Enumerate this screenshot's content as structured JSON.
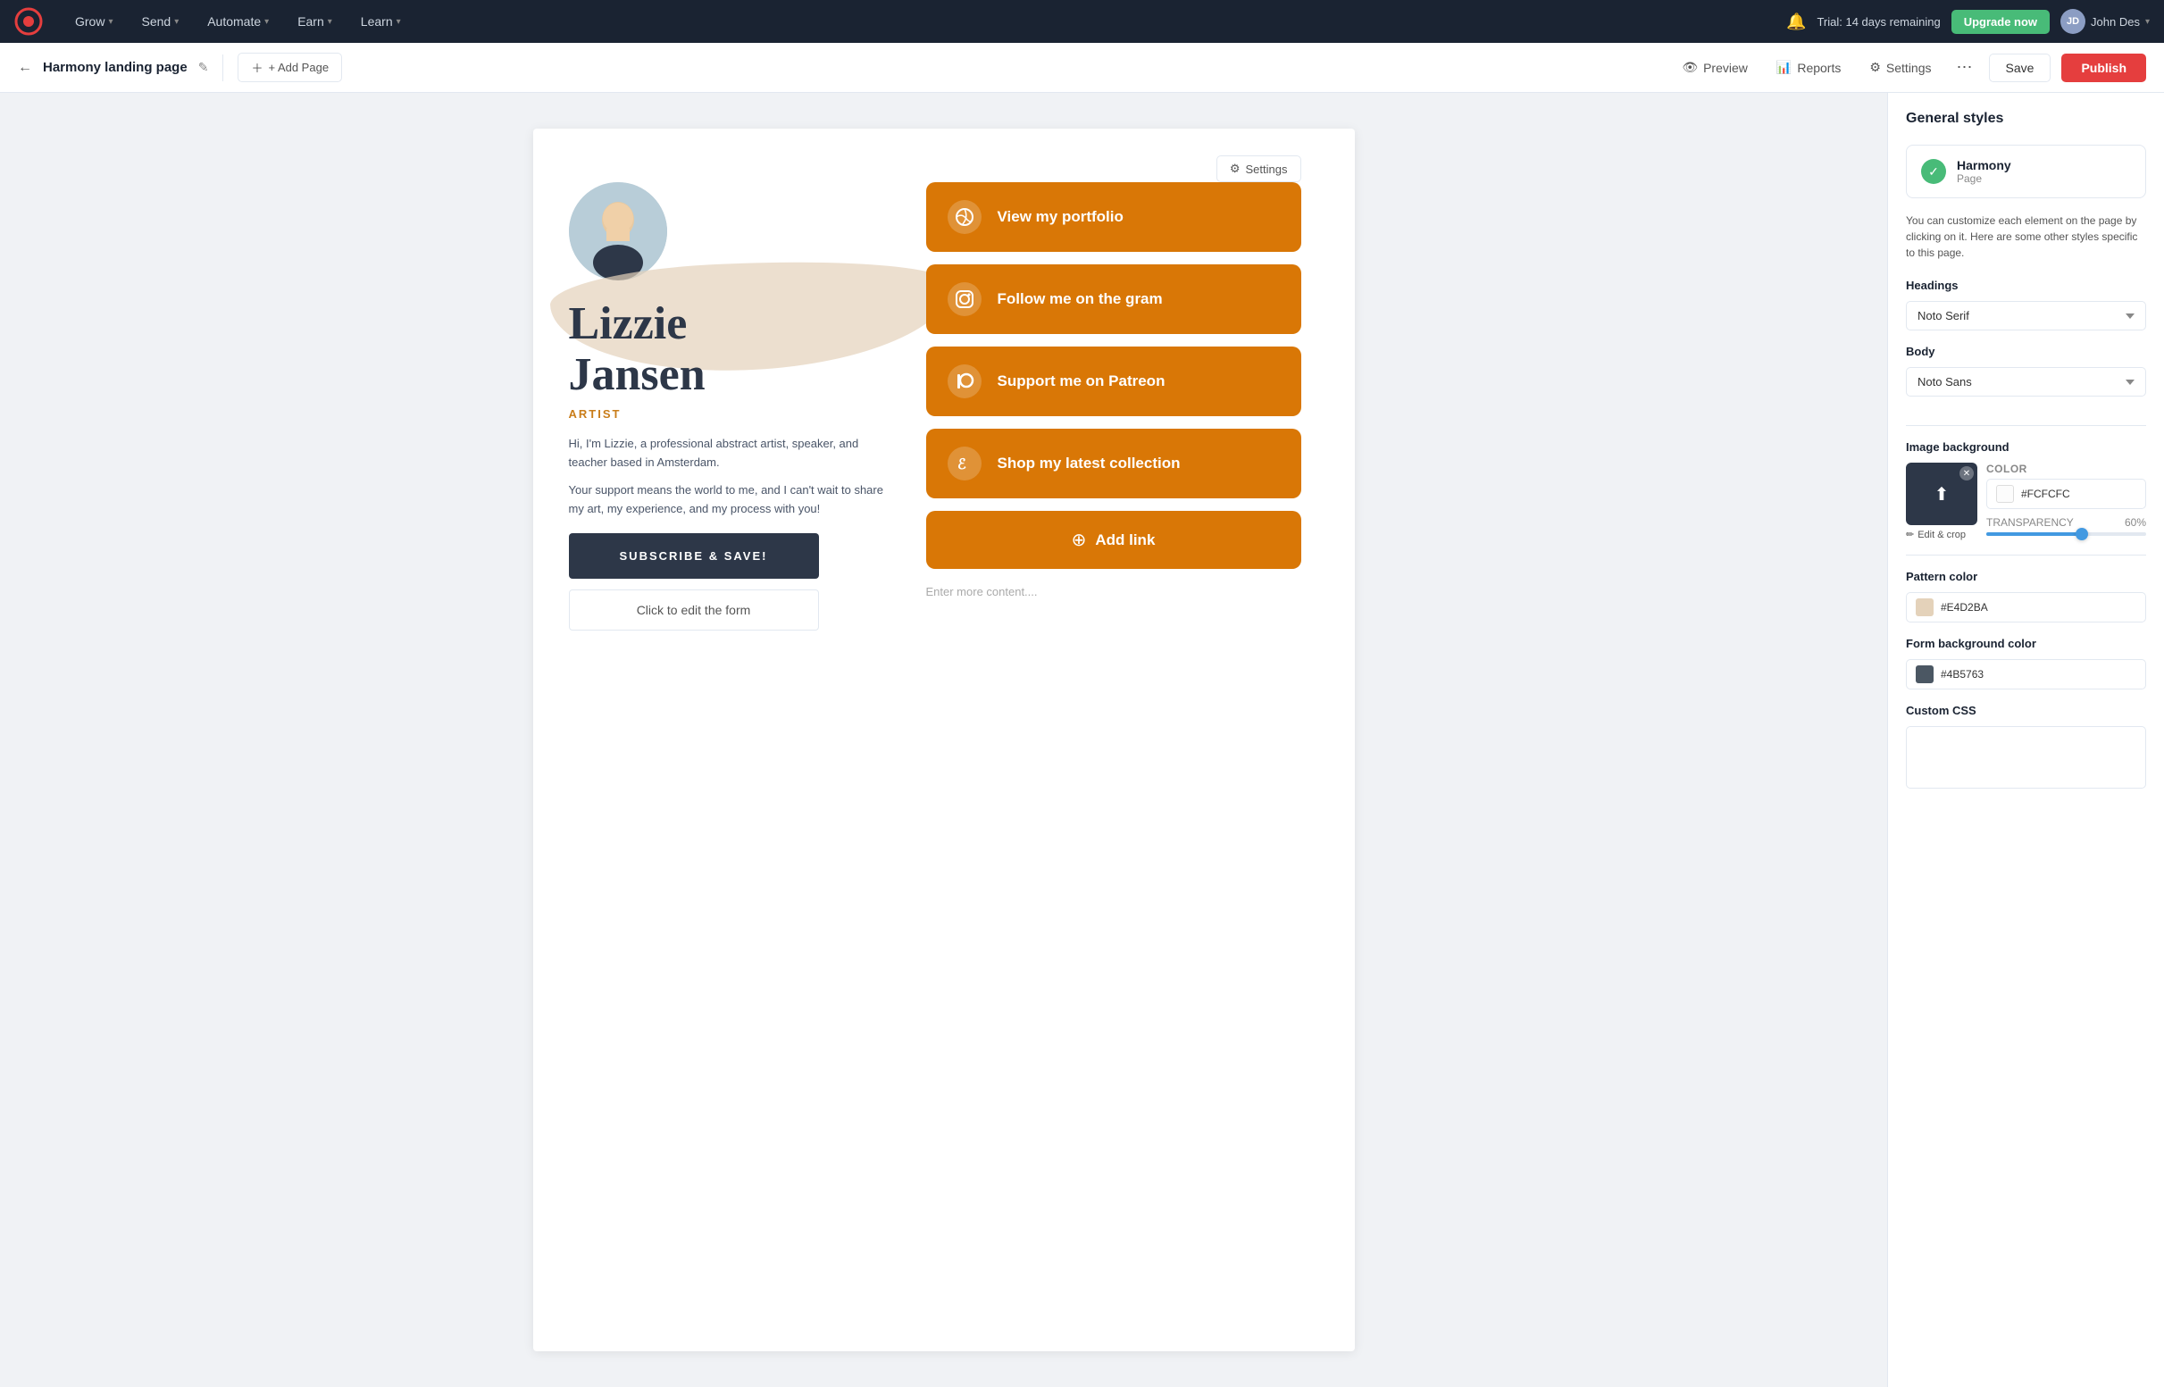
{
  "topnav": {
    "logo_label": "ActiveCampaign",
    "nav_items": [
      {
        "id": "grow",
        "label": "Grow"
      },
      {
        "id": "send",
        "label": "Send"
      },
      {
        "id": "automate",
        "label": "Automate"
      },
      {
        "id": "earn",
        "label": "Earn"
      },
      {
        "id": "learn",
        "label": "Learn"
      }
    ],
    "trial_text": "Trial: 14 days remaining",
    "upgrade_label": "Upgrade now",
    "user_name": "John Des"
  },
  "toolbar": {
    "back_label": "←",
    "page_title": "Harmony landing page",
    "edit_icon": "✎",
    "add_page_label": "+ Add Page",
    "preview_label": "Preview",
    "reports_label": "Reports",
    "settings_label": "Settings",
    "save_label": "Save",
    "publish_label": "Publish"
  },
  "canvas": {
    "settings_float_label": "Settings",
    "profile_name_first": "Lizzie",
    "profile_name_last": "Jansen",
    "profile_title": "ARTIST",
    "bio_line1": "Hi, I'm Lizzie, a professional abstract artist, speaker, and teacher based in Amsterdam.",
    "bio_line2": "Your support means the world to me, and I can't wait to share my art, my experience, and my process with you!",
    "subscribe_label": "SUBSCRIBE & SAVE!",
    "edit_form_label": "Click to edit the form",
    "links": [
      {
        "id": "portfolio",
        "icon": "⊕",
        "icon_type": "dribbble",
        "label": "View my portfolio"
      },
      {
        "id": "instagram",
        "icon": "◎",
        "icon_type": "instagram",
        "label": "Follow me on the gram"
      },
      {
        "id": "patreon",
        "icon": "⏺",
        "icon_type": "patreon",
        "label": "Support me on Patreon"
      },
      {
        "id": "shop",
        "icon": "ℰ",
        "icon_type": "etsy",
        "label": "Shop my latest collection"
      }
    ],
    "add_link_label": "Add link",
    "enter_content_label": "Enter more content...."
  },
  "panel": {
    "title": "General styles",
    "harmony_name": "Harmony",
    "harmony_sub": "Page",
    "harmony_desc": "You can customize each element on the page by clicking on it. Here are some other styles specific to this page.",
    "headings_label": "Headings",
    "headings_value": "Noto Serif",
    "body_label": "Body",
    "body_value": "Noto Sans",
    "image_bg_label": "Image background",
    "color_label": "COLOR",
    "color_value": "#FCFCFC",
    "transparency_label": "TRANSPARENCY",
    "transparency_value": "60%",
    "transparency_pct": 60,
    "edit_crop_label": "Edit & crop",
    "pattern_color_label": "Pattern color",
    "pattern_color_value": "#E4D2BA",
    "form_bg_label": "Form background color",
    "form_bg_value": "#4B5763",
    "custom_css_label": "Custom CSS",
    "custom_css_placeholder": ""
  }
}
